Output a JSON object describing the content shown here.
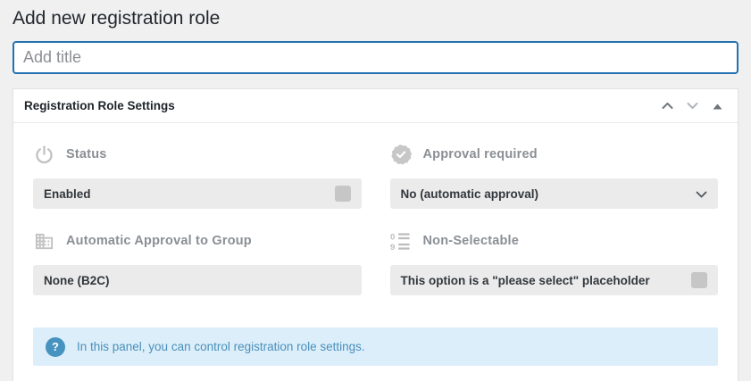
{
  "page": {
    "title": "Add new registration role"
  },
  "title_field": {
    "placeholder": "Add title",
    "value": ""
  },
  "metabox": {
    "title": "Registration Role Settings",
    "controls": {
      "move_up_icon": "chevron-up-icon",
      "move_down_icon": "chevron-down-icon",
      "toggle_icon": "triangle-up-icon"
    }
  },
  "sections": {
    "status": {
      "label": "Status",
      "icon": "power-icon",
      "field_text": "Enabled",
      "checkbox_checked": false
    },
    "approval_required": {
      "label": "Approval required",
      "icon": "verified-badge-icon",
      "selected_option": "No (automatic approval)"
    },
    "automatic_approval_group": {
      "label": "Automatic Approval to Group",
      "icon": "building-icon",
      "field_text": "None (B2C)"
    },
    "non_selectable": {
      "label": "Non-Selectable",
      "icon": "numbered-list-icon",
      "field_text": "This option is a \"please select\" placeholder",
      "checkbox_checked": false
    }
  },
  "info_panel": {
    "icon": "question-mark-icon",
    "text": "In this panel, you can control registration role settings."
  },
  "colors": {
    "accent_blue": "#2271b1",
    "page_background": "#f0f0f1",
    "field_background": "#ebebeb",
    "checkbox_gray": "#c6c6c6",
    "icon_gray": "#c2c2c2",
    "label_gray": "#8b8f94",
    "info_background": "#dceefa",
    "info_blue": "#4a90ba"
  }
}
